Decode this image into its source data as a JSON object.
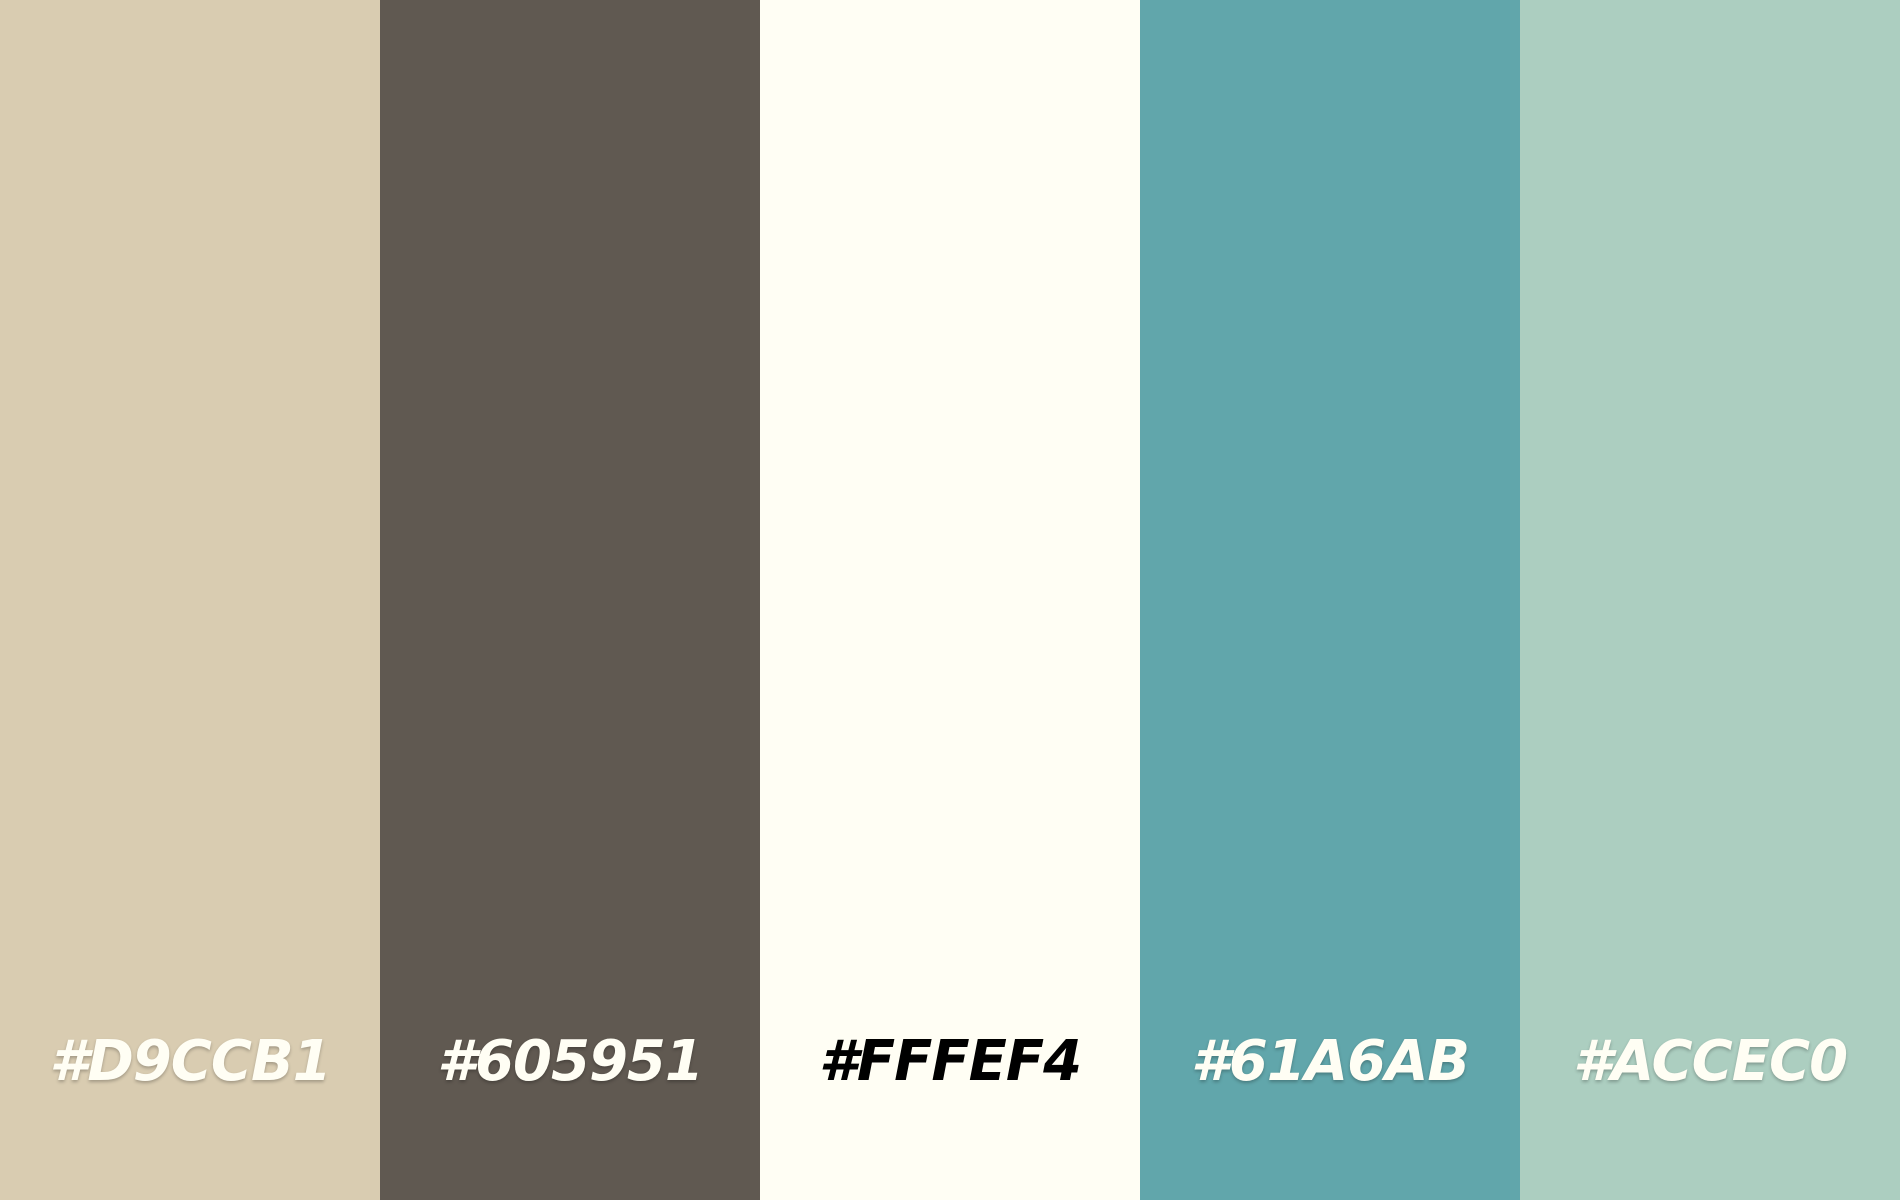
{
  "palette": {
    "swatches": [
      {
        "label": "#D9CCB1",
        "color": "#D9CCB1",
        "text_color": "#FFFEF4"
      },
      {
        "label": "#605951",
        "color": "#605951",
        "text_color": "#FFFEF4"
      },
      {
        "label": "#FFFEF4",
        "color": "#FFFEF4",
        "text_color": "#000000"
      },
      {
        "label": "#61A6AB",
        "color": "#61A6AB",
        "text_color": "#FFFEF4"
      },
      {
        "label": "#ACCEC0",
        "color": "#ACCEC0",
        "text_color": "#FFFEF4"
      }
    ]
  }
}
